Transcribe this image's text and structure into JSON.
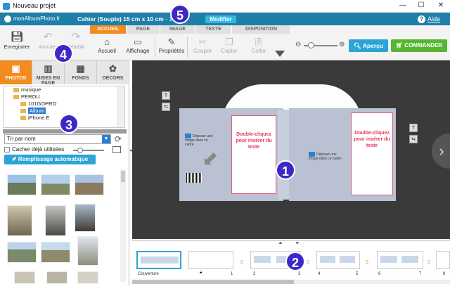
{
  "window": {
    "title": "Nouveau projet",
    "minimize": "—",
    "maximize": "☐",
    "close": "✕"
  },
  "header": {
    "logo": "monAlbumPhoto.fr",
    "product": "Cahier (Souple) 15 cm x 10 cm",
    "price": "- 16 p",
    "price_tail": "€",
    "modify_label": "Modifier",
    "help_label": "Aide"
  },
  "toolbar": {
    "save": "Enregistrer",
    "undo": "Annuler",
    "redo": "Rétablir",
    "tabs": [
      "ACCUEIL",
      "PAGE",
      "IMAGE",
      "TEXTE",
      "DISPOSITION"
    ],
    "tools": [
      "Accueil",
      "Affichage",
      "Propriétés",
      "Couper",
      "Copier",
      "Coller"
    ],
    "preview": "Aperçu",
    "order": "COMMANDER"
  },
  "left_panel": {
    "tabs": [
      "PHOTOS",
      "MISES EN PAGE",
      "FONDS",
      "DECORS"
    ],
    "tree": [
      "musique",
      "PEROU",
      "101GOPRO",
      "Album",
      "iPhone E"
    ],
    "sort": "Tri par nom",
    "hide_used": "Cacher déjà utilisées",
    "autofill": "Remplissage automatique"
  },
  "canvas": {
    "double_click_text": "Double-cliquez pour insérer du texte",
    "drop_image_text": "Déposer une image dans ce cadre"
  },
  "strip": {
    "cover": "Couverture",
    "page_numbers": [
      "1",
      "2",
      "3",
      "4",
      "5",
      "6",
      "7",
      "8"
    ]
  },
  "badges": [
    "1",
    "2",
    "3",
    "4",
    "5"
  ]
}
